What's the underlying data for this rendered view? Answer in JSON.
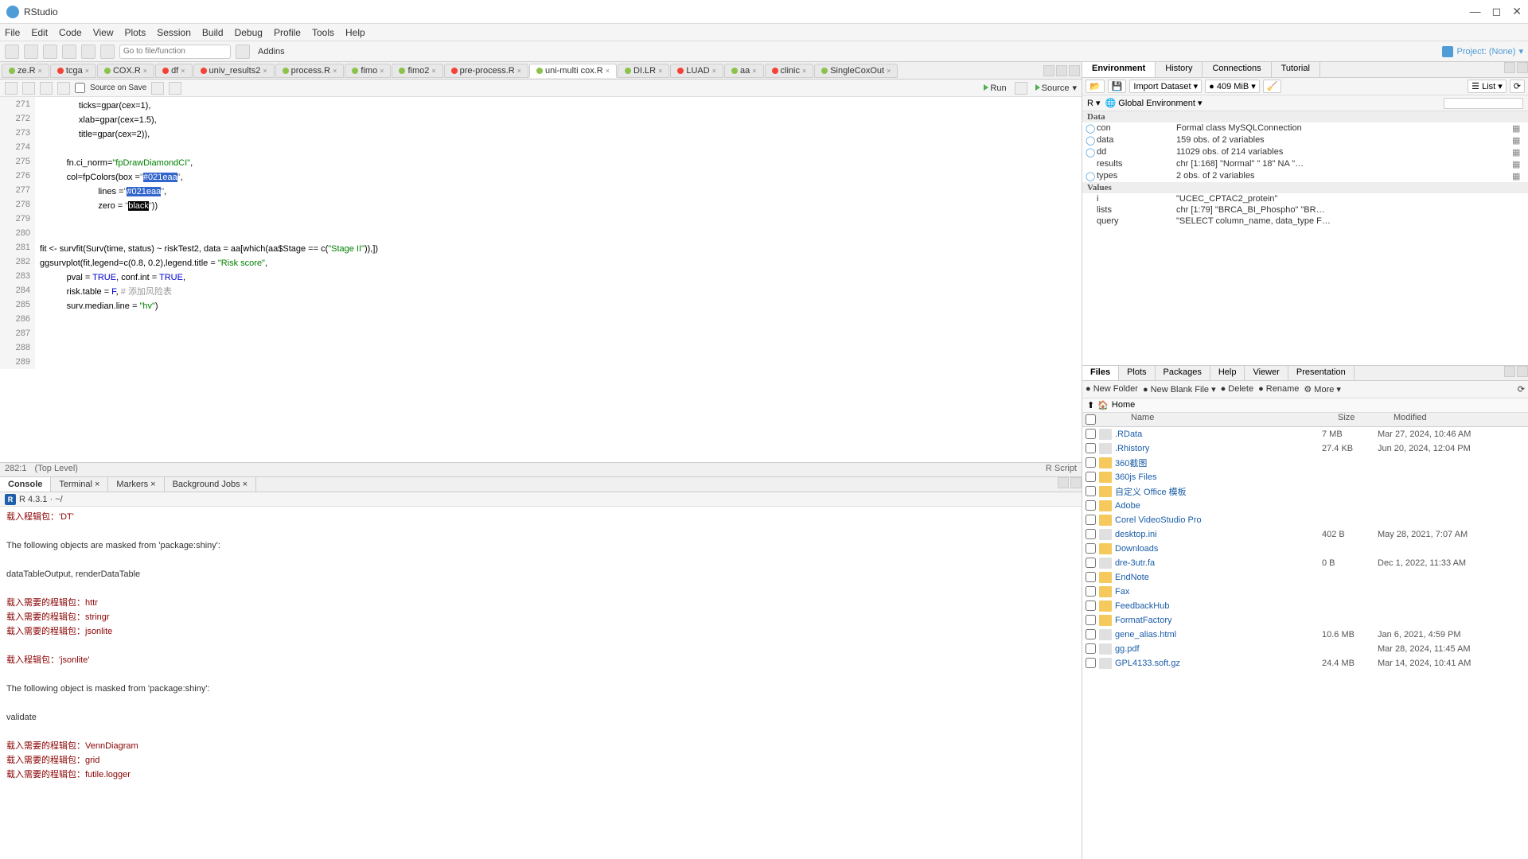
{
  "window": {
    "title": "RStudio"
  },
  "menu": [
    "File",
    "Edit",
    "Code",
    "View",
    "Plots",
    "Session",
    "Build",
    "Debug",
    "Profile",
    "Tools",
    "Help"
  ],
  "toolbar": {
    "goto_placeholder": "Go to file/function",
    "addins": "Addins",
    "project": "Project: (None)"
  },
  "source_tabs": [
    "ze.R",
    "tcga",
    "COX.R",
    "df",
    "univ_results2",
    "process.R",
    "fimo",
    "fimo2",
    "pre-process.R",
    "uni-multi cox.R",
    "DI.LR",
    "LUAD",
    "aa",
    "clinic",
    "SingleCoxOut"
  ],
  "source_tab_red": [
    1,
    3,
    4,
    8,
    11,
    13
  ],
  "source_toolbar": {
    "sos": "Source on Save",
    "run": "Run",
    "source": "Source"
  },
  "code_lines": [
    {
      "n": 271,
      "t": "                ticks=gpar(cex=1),"
    },
    {
      "n": 272,
      "t": "                xlab=gpar(cex=1.5),"
    },
    {
      "n": 273,
      "t": "                title=gpar(cex=2)),"
    },
    {
      "n": 274,
      "t": ""
    },
    {
      "n": 275,
      "t": "           fn.ci_norm=\"fpDrawDiamondCI\","
    },
    {
      "n": 276,
      "t": "           col=fpColors(box =\"#021eaa\","
    },
    {
      "n": 277,
      "t": "                        lines =\"#021eaa\","
    },
    {
      "n": 278,
      "t": "                        zero = \"black\"))"
    },
    {
      "n": 279,
      "t": ""
    },
    {
      "n": 280,
      "t": ""
    },
    {
      "n": 281,
      "t": "fit <- survfit(Surv(time, status) ~ riskTest2, data = aa[which(aa$Stage == c(\"Stage II\")),])"
    },
    {
      "n": 282,
      "t": "ggsurvplot(fit,legend=c(0.8, 0.2),legend.title = \"Risk score\","
    },
    {
      "n": 283,
      "t": "           pval = TRUE, conf.int = TRUE,"
    },
    {
      "n": 284,
      "t": "           risk.table = F, # 添加风险表"
    },
    {
      "n": 285,
      "t": "           surv.median.line = \"hv\")"
    },
    {
      "n": 286,
      "t": ""
    },
    {
      "n": 287,
      "t": ""
    },
    {
      "n": 288,
      "t": ""
    },
    {
      "n": 289,
      "t": ""
    }
  ],
  "status": {
    "pos": "282:1",
    "scope": "(Top Level)",
    "type": "R Script"
  },
  "console_tabs": [
    "Console",
    "Terminal",
    "Markers",
    "Background Jobs"
  ],
  "console_hdr": "R 4.3.1 · ~/",
  "console_lines": [
    {
      "c": "msg",
      "t": "载入程辑包：'DT'"
    },
    {
      "c": "",
      "t": ""
    },
    {
      "c": "pkg",
      "t": "The following objects are masked from 'package:shiny':"
    },
    {
      "c": "",
      "t": ""
    },
    {
      "c": "pkg",
      "t": "    dataTableOutput, renderDataTable"
    },
    {
      "c": "",
      "t": ""
    },
    {
      "c": "msg",
      "t": "载入需要的程辑包：httr"
    },
    {
      "c": "msg",
      "t": "载入需要的程辑包：stringr"
    },
    {
      "c": "msg",
      "t": "载入需要的程辑包：jsonlite"
    },
    {
      "c": "",
      "t": ""
    },
    {
      "c": "msg",
      "t": "载入程辑包：'jsonlite'"
    },
    {
      "c": "",
      "t": ""
    },
    {
      "c": "pkg",
      "t": "The following object is masked from 'package:shiny':"
    },
    {
      "c": "",
      "t": ""
    },
    {
      "c": "pkg",
      "t": "    validate"
    },
    {
      "c": "",
      "t": ""
    },
    {
      "c": "msg",
      "t": "载入需要的程辑包：VennDiagram"
    },
    {
      "c": "msg",
      "t": "载入需要的程辑包：grid"
    },
    {
      "c": "msg",
      "t": "载入需要的程辑包：futile.logger"
    }
  ],
  "env_tabs": [
    "Environment",
    "History",
    "Connections",
    "Tutorial"
  ],
  "env_toolbar": {
    "import": "Import Dataset",
    "mem": "409 MiB",
    "list": "List"
  },
  "env_scope": "Global Environment",
  "env_data_label": "Data",
  "env_values_label": "Values",
  "env_data": [
    {
      "n": "con",
      "v": "Formal class  MySQLConnection",
      "e": true
    },
    {
      "n": "data",
      "v": "159 obs. of 2 variables",
      "e": true
    },
    {
      "n": "dd",
      "v": "11029 obs. of 214 variables",
      "e": true
    },
    {
      "n": "results",
      "v": "chr [1:168] \"Normal\" \" 18\" NA \"…",
      "e": false
    },
    {
      "n": "types",
      "v": "2 obs. of 2 variables",
      "e": true
    }
  ],
  "env_values": [
    {
      "n": "i",
      "v": "\"UCEC_CPTAC2_protein\""
    },
    {
      "n": "lists",
      "v": "chr [1:79] \"BRCA_BI_Phospho\" \"BR…"
    },
    {
      "n": "query",
      "v": "\"SELECT column_name, data_type F…"
    }
  ],
  "files_tabs": [
    "Files",
    "Plots",
    "Packages",
    "Help",
    "Viewer",
    "Presentation"
  ],
  "files_toolbar": {
    "newfolder": "New Folder",
    "newfile": "New Blank File",
    "delete": "Delete",
    "rename": "Rename",
    "more": "More"
  },
  "crumb": "Home",
  "file_headers": {
    "name": "Name",
    "size": "Size",
    "modified": "Modified"
  },
  "files": [
    {
      "n": ".RData",
      "t": "file",
      "s": "7 MB",
      "m": "Mar 27, 2024, 10:46 AM"
    },
    {
      "n": ".Rhistory",
      "t": "file",
      "s": "27.4 KB",
      "m": "Jun 20, 2024, 12:04 PM"
    },
    {
      "n": "360截图",
      "t": "folder",
      "s": "",
      "m": ""
    },
    {
      "n": "360js Files",
      "t": "folder",
      "s": "",
      "m": ""
    },
    {
      "n": "自定义 Office 模板",
      "t": "folder",
      "s": "",
      "m": ""
    },
    {
      "n": "Adobe",
      "t": "folder",
      "s": "",
      "m": ""
    },
    {
      "n": "Corel VideoStudio Pro",
      "t": "folder",
      "s": "",
      "m": ""
    },
    {
      "n": "desktop.ini",
      "t": "file",
      "s": "402 B",
      "m": "May 28, 2021, 7:07 AM"
    },
    {
      "n": "Downloads",
      "t": "folder",
      "s": "",
      "m": ""
    },
    {
      "n": "dre-3utr.fa",
      "t": "file",
      "s": "0 B",
      "m": "Dec 1, 2022, 11:33 AM"
    },
    {
      "n": "EndNote",
      "t": "folder",
      "s": "",
      "m": ""
    },
    {
      "n": "Fax",
      "t": "folder",
      "s": "",
      "m": ""
    },
    {
      "n": "FeedbackHub",
      "t": "folder",
      "s": "",
      "m": ""
    },
    {
      "n": "FormatFactory",
      "t": "folder",
      "s": "",
      "m": ""
    },
    {
      "n": "gene_alias.html",
      "t": "file",
      "s": "10.6 MB",
      "m": "Jan 6, 2021, 4:59 PM"
    },
    {
      "n": "gg.pdf",
      "t": "file",
      "s": "",
      "m": "Mar 28, 2024, 11:45 AM"
    },
    {
      "n": "GPL4133.soft.gz",
      "t": "file",
      "s": "24.4 MB",
      "m": "Mar 14, 2024, 10:41 AM"
    }
  ]
}
